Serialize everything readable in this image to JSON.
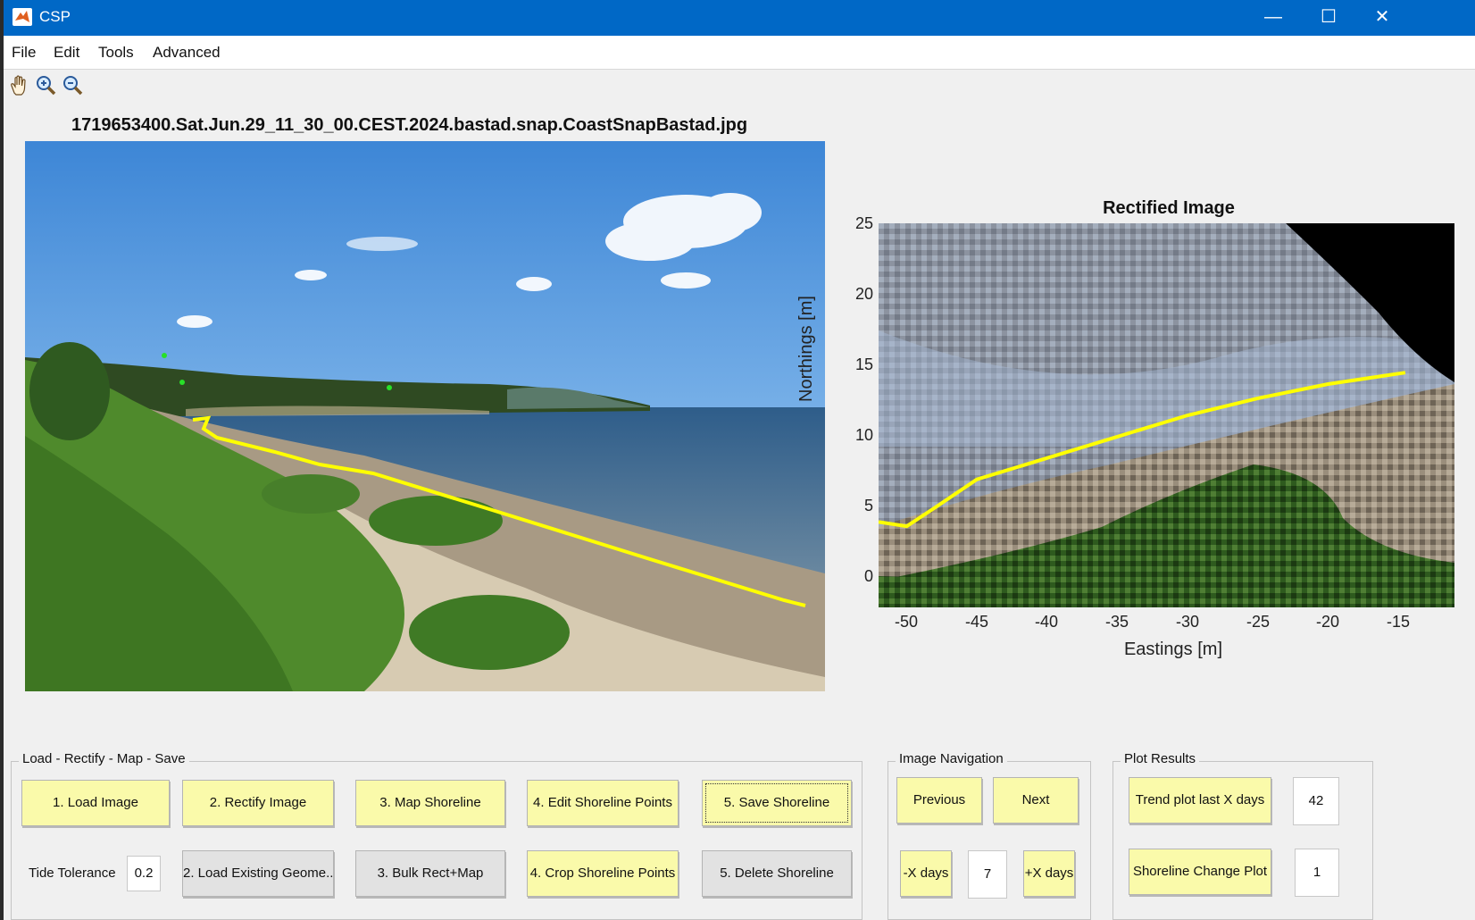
{
  "window": {
    "title": "CSP",
    "controls": {
      "minimize": "—",
      "maximize": "☐",
      "close": "✕"
    }
  },
  "menubar": [
    "File",
    "Edit",
    "Tools",
    "Advanced"
  ],
  "toolbar": {
    "tools": [
      "pan-hand-icon",
      "zoom-in-icon",
      "zoom-out-icon"
    ]
  },
  "image": {
    "filename": "1719653400.Sat.Jun.29_11_30_00.CEST.2024.bastad.snap.CoastSnapBastad.jpg"
  },
  "rectified": {
    "title": "Rectified Image",
    "xlabel": "Eastings [m]",
    "ylabel": "Northings [m]",
    "xticks": [
      "-50",
      "-45",
      "-40",
      "-35",
      "-30",
      "-25",
      "-20",
      "-15"
    ],
    "yticks": [
      "25",
      "20",
      "15",
      "10",
      "5",
      "0"
    ],
    "xlim": [
      -52,
      -11
    ],
    "ylim": [
      -1.5,
      25.5
    ],
    "shoreline": [
      [
        -52,
        4.5
      ],
      [
        -50,
        4.2
      ],
      [
        -48,
        5.5
      ],
      [
        -45,
        7.5
      ],
      [
        -40,
        9
      ],
      [
        -35,
        10.5
      ],
      [
        -30,
        12
      ],
      [
        -25,
        13.2
      ],
      [
        -20,
        14.2
      ],
      [
        -14.5,
        15
      ]
    ],
    "shoreline_color": "#ffff00"
  },
  "panels": {
    "workflow": {
      "title": "Load - Rectify - Map - Save",
      "row1": [
        "1. Load Image",
        "2. Rectify Image",
        "3. Map Shoreline",
        "4. Edit Shoreline Points",
        "5. Save Shoreline"
      ],
      "tide_label": "Tide Tolerance",
      "tide_value": "0.2",
      "row2": [
        "2. Load Existing Geome...",
        "3. Bulk Rect+Map",
        "4. Crop Shoreline Points",
        "5. Delete Shoreline"
      ]
    },
    "navigation": {
      "title": "Image Navigation",
      "previous": "Previous",
      "next": "Next",
      "minus_days": "-X days",
      "days_value": "7",
      "plus_days": "+X days"
    },
    "results": {
      "title": "Plot Results",
      "trend": "Trend plot last X days",
      "trend_value": "42",
      "change": "Shoreline Change Plot",
      "change_value": "1"
    }
  },
  "colors": {
    "titlebar": "#0068c6",
    "button_yellow": "#fafaaa",
    "button_gray": "#e2e2e2"
  }
}
